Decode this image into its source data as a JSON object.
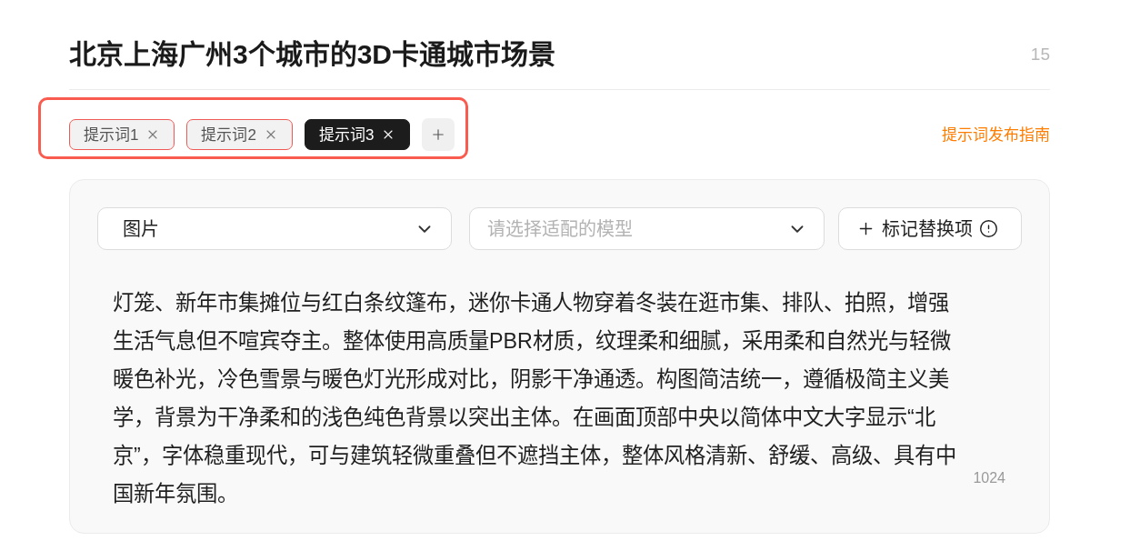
{
  "title": "北京上海广州3个城市的3D卡通城市场景",
  "title_count": "15",
  "tags": [
    {
      "label": "提示词1",
      "selected": false,
      "error": true
    },
    {
      "label": "提示词2",
      "selected": false,
      "error": true
    },
    {
      "label": "提示词3",
      "selected": true,
      "error": false
    }
  ],
  "guide_link": "提示词发布指南",
  "editor": {
    "type_select": {
      "value": "图片"
    },
    "model_select": {
      "placeholder": "请选择适配的模型"
    },
    "mark_button": "标记替换项",
    "prompt": "灯笼、新年市集摊位与红白条纹篷布，迷你卡通人物穿着冬装在逛市集、排队、拍照，增强生活气息但不喧宾夺主。整体使用高质量PBR材质，纹理柔和细腻，采用柔和自然光与轻微暖色补光，冷色雪景与暖色灯光形成对比，阴影干净通透。构图简洁统一，遵循极简主义美学，背景为干净柔和的浅色纯色背景以突出主体。在画面顶部中央以简体中文大字显示“北京”，字体稳重现代，可与建筑轻微重叠但不遮挡主体，整体风格清新、舒缓、高级、具有中国新年氛围。",
    "char_count": "1024"
  }
}
